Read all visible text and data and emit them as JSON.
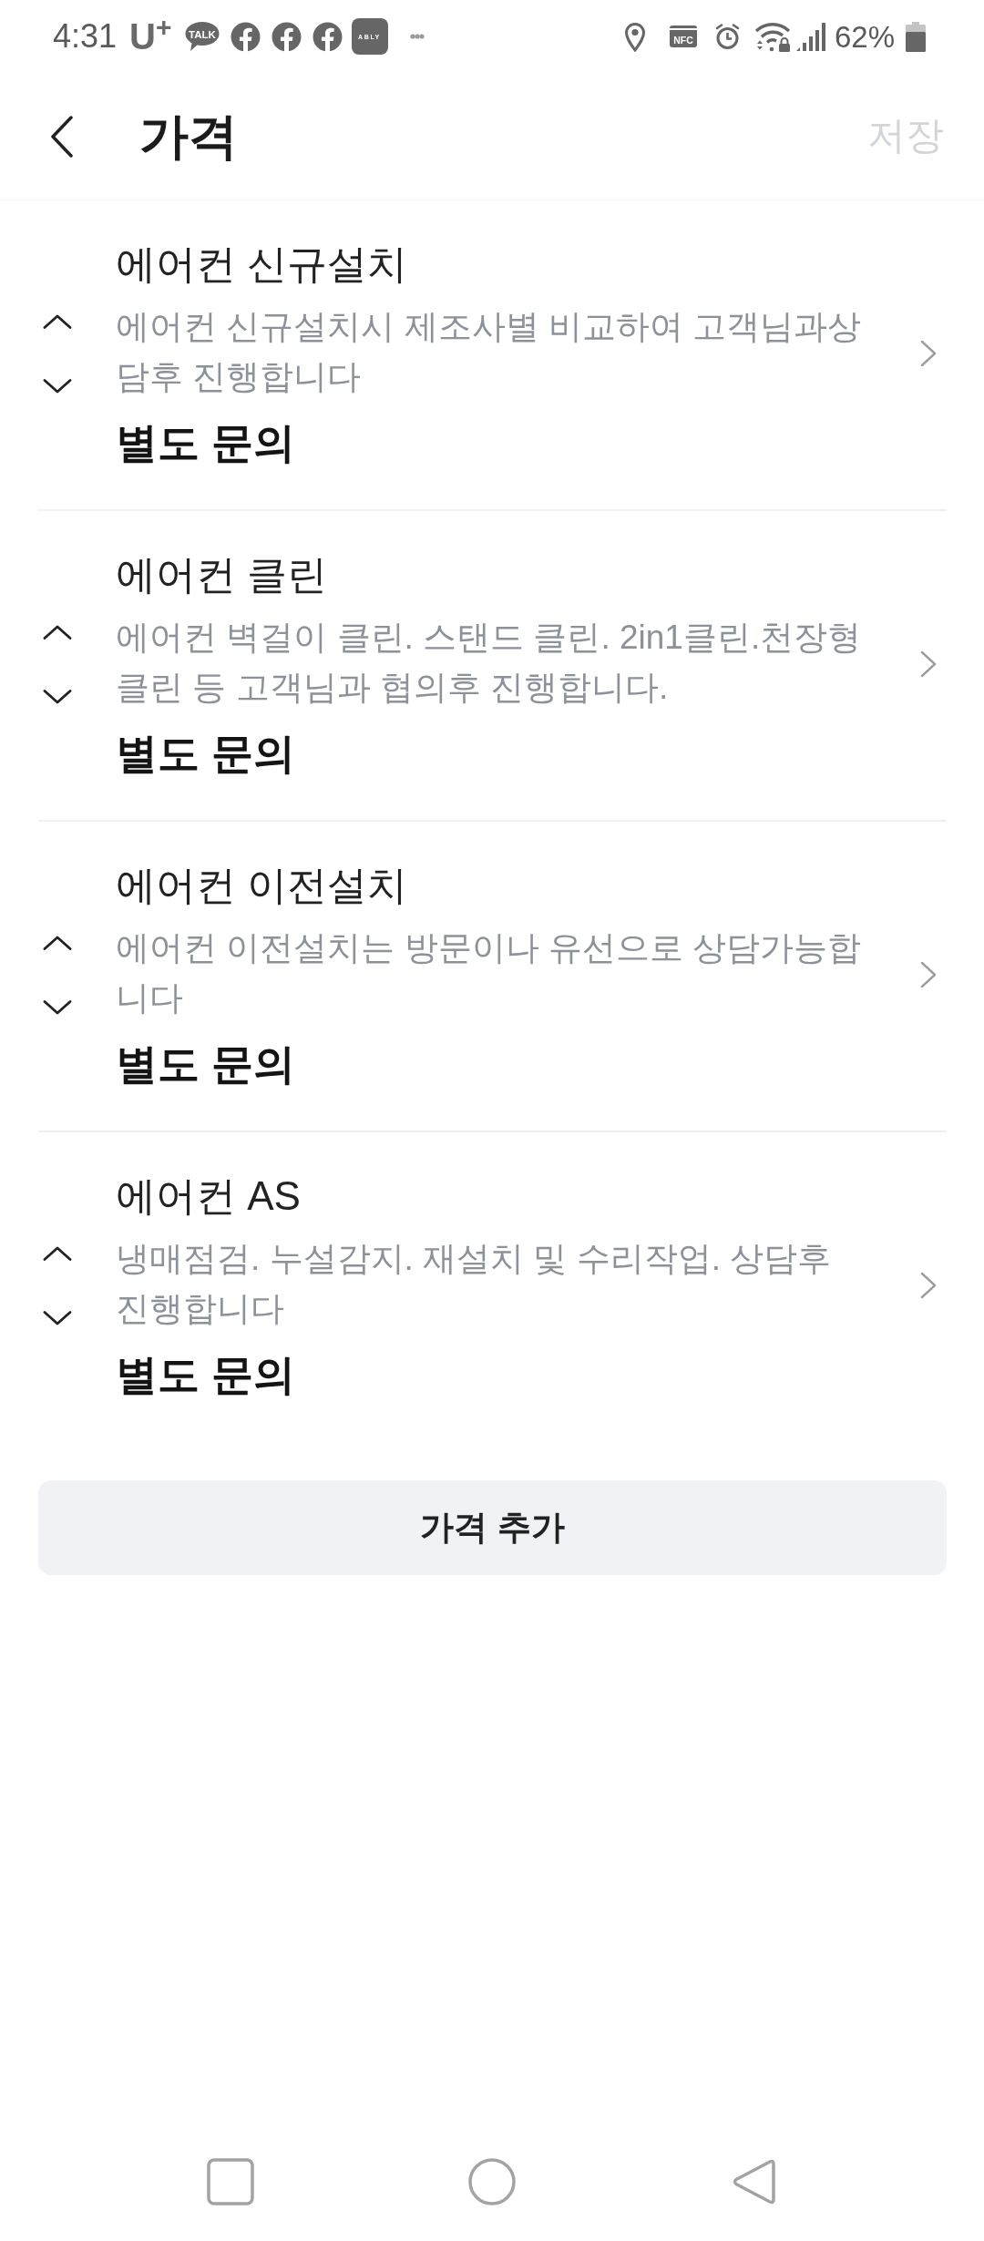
{
  "status_bar": {
    "time": "4:31",
    "carrier": "U$^{+}$",
    "notification_icons": [
      {
        "kind": "talk",
        "label": "TALK"
      },
      {
        "kind": "facebook"
      },
      {
        "kind": "facebook"
      },
      {
        "kind": "facebook"
      },
      {
        "kind": "app",
        "label": "ABLY"
      },
      {
        "kind": "more"
      }
    ],
    "system_icons": [
      {
        "kind": "location"
      },
      {
        "kind": "nfc",
        "label": "NFC"
      },
      {
        "kind": "alarm"
      },
      {
        "kind": "wifi"
      },
      {
        "kind": "signal"
      }
    ],
    "battery": "62%"
  },
  "header": {
    "title": "가격",
    "save_button": {
      "label": "저장",
      "disabled": true
    }
  },
  "price_items": [
    {
      "title": "에어컨 신규설치",
      "description": "에어컨 신규설치시 제조사별 비교하여 고객님과상담후 진행합니다",
      "price": "별도 문의"
    },
    {
      "title": "에어컨 클린",
      "description": "에어컨 벽걸이 클린. 스탠드 클린. 2in1클린.천장형 클린 등 고객님과 협의후 진행합니다.",
      "price": "별도 문의"
    },
    {
      "title": "에어컨 이전설치",
      "description": "에어컨 이전설치는 방문이나 유선으로 상담가능합니다",
      "price": "별도 문의"
    },
    {
      "title": "에어컨 AS",
      "description": "냉매점검. 누설감지. 재설치 및 수리작업. 상담후 진행합니다",
      "price": "별도 문의"
    }
  ],
  "add_button": "가격 추가",
  "nav_bar": [
    {
      "kind": "recents"
    },
    {
      "kind": "home"
    },
    {
      "kind": "back"
    }
  ]
}
